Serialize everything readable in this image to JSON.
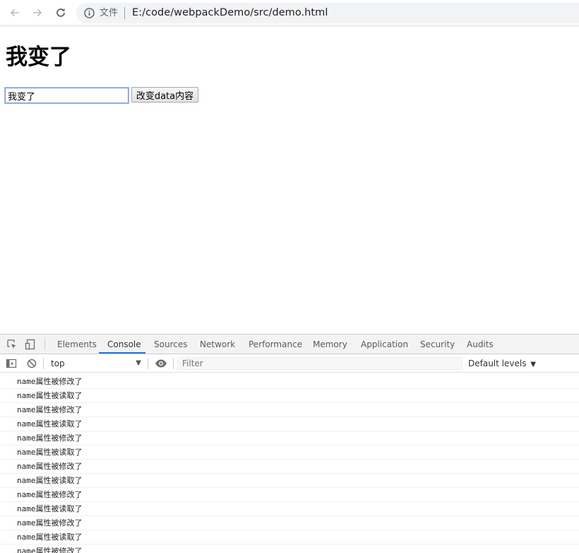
{
  "browser": {
    "omnibox": {
      "file_label": "文件",
      "url": "E:/code/webpackDemo/src/demo.html"
    },
    "icons": [
      "back-arrow-icon",
      "forward-arrow-icon",
      "reload-icon",
      "info-icon"
    ]
  },
  "page": {
    "heading": "我变了",
    "input_value": "我变了",
    "button_label": "改变data内容"
  },
  "devtools": {
    "tabs": [
      "Elements",
      "Console",
      "Sources",
      "Network",
      "Performance",
      "Memory",
      "Application",
      "Security",
      "Audits"
    ],
    "active_tab": "Console",
    "context": "top",
    "filter_placeholder": "Filter",
    "levels_label": "Default levels",
    "logs": [
      "name属性被修改了",
      "name属性被读取了",
      "name属性被修改了",
      "name属性被读取了",
      "name属性被修改了",
      "name属性被读取了",
      "name属性被修改了",
      "name属性被读取了",
      "name属性被修改了",
      "name属性被读取了",
      "name属性被修改了",
      "name属性被读取了",
      "name属性被修改了"
    ],
    "accent_color": "#1a73e8"
  }
}
